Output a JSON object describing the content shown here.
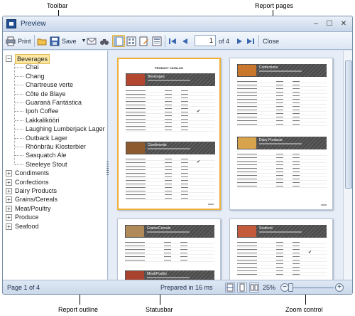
{
  "callouts": {
    "toolbar": "Toolbar",
    "report_pages": "Report pages",
    "report_outline": "Report outline",
    "statusbar": "Statusbar",
    "zoom_control": "Zoom control"
  },
  "window": {
    "title": "Preview",
    "minimize": "–",
    "maximize": "☐",
    "close": "✕"
  },
  "toolbar": {
    "print_label": "Print",
    "save_label": "Save",
    "page_value": "1",
    "page_of": "of 4",
    "close_label": "Close"
  },
  "outline": {
    "expanded": {
      "label": "Beverages",
      "children": [
        "Chai",
        "Chang",
        "Chartreuse verte",
        "Côte de Blaye",
        "Guaraná Fantástica",
        "Ipoh Coffee",
        "Lakkalikööri",
        "Laughing Lumberjack Lager",
        "Outback Lager",
        "Rhönbräu Klosterbier",
        "Sasquatch Ale",
        "Steeleye Stout"
      ]
    },
    "collapsed": [
      "Condiments",
      "Confections",
      "Dairy Products",
      "Grains/Cereals",
      "Meat/Poultry",
      "Produce",
      "Seafood"
    ]
  },
  "pages": {
    "p1_title": "PRODUCT CATALOG",
    "p1_cat1": "Beverages",
    "p1_cat2": "Condiments",
    "p2_cat1": "Confections",
    "p2_cat2": "Dairy Products",
    "p3_cat1": "Grains/Cereals",
    "p3_cat2": "Meat/Poultry",
    "p4_cat1": "Seafood"
  },
  "statusbar": {
    "page_info": "Page 1 of 4",
    "prepared": "Prepared in 16 ms",
    "zoom": "25%",
    "zoom_minus": "−",
    "zoom_plus": "+"
  },
  "colors": {
    "accent": "#f0b13b",
    "selection": "#fde8a4",
    "chrome": "#d9e4f1"
  }
}
